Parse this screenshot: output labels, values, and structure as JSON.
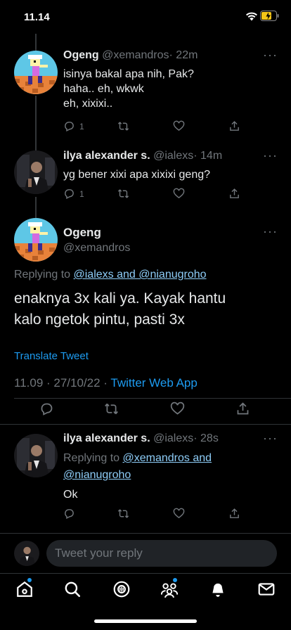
{
  "status_bar": {
    "time": "11.14"
  },
  "tweets": [
    {
      "name": "Ogeng",
      "handle": "@xemandros",
      "time": "· 22m",
      "text_lines": [
        "isinya bakal apa nih, Pak?",
        "haha.. eh, wkwk",
        "eh, xixixi.."
      ],
      "reply_count": "1"
    },
    {
      "name": "ilya alexander s.",
      "handle": "@ialexs",
      "time": "· 14m",
      "text_lines": [
        "yg bener xixi apa xixixi geng?"
      ],
      "reply_count": "1"
    }
  ],
  "focused": {
    "name": "Ogeng",
    "handle": "@xemandros",
    "replying_prefix": "Replying to ",
    "replying_to": "@ialexs and @nianugroho",
    "text_lines": [
      "enaknya 3x kali ya. Kayak hantu",
      "kalo ngetok pintu, pasti 3x"
    ],
    "translate": "Translate Tweet",
    "timestamp": "11.09 · 27/10/22 · ",
    "source": "Twitter Web App"
  },
  "reply": {
    "name": "ilya alexander s.",
    "handle": "@ialexs",
    "time": "· 28s",
    "replying_prefix": "Replying to ",
    "replying_to_line1": "@xemandros and",
    "replying_to_line2": "@nianugroho",
    "text": "Ok"
  },
  "composer": {
    "placeholder": "Tweet your reply"
  },
  "more_glyph": "···",
  "colors": {
    "accent": "#1d9bf0",
    "link": "#8ecdf8",
    "muted": "#71767b",
    "background": "#000000"
  }
}
